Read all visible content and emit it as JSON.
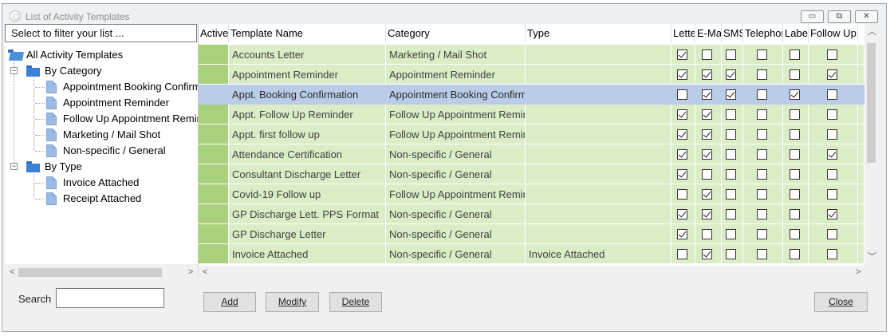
{
  "window": {
    "title": "List of Activity Templates",
    "controls": [
      "▭",
      "⧉",
      "✕"
    ]
  },
  "filter": {
    "placeholder": "Select to filter your list ..."
  },
  "tree": {
    "root": "All Activity Templates",
    "by_category": {
      "label": "By Category",
      "items": [
        "Appointment Booking Confirmation",
        "Appointment Reminder",
        "Follow Up Appointment Reminder",
        "Marketing / Mail Shot",
        "Non-specific / General"
      ]
    },
    "by_type": {
      "label": "By Type",
      "items": [
        "Invoice Attached",
        "Receipt Attached"
      ]
    }
  },
  "grid": {
    "columns": [
      "Active",
      "Template Name",
      "Category",
      "Type",
      "Letter",
      "E-Mail",
      "SMS",
      "Telephone",
      "Label",
      "Follow Up"
    ],
    "rows": [
      {
        "name": "Accounts Letter",
        "category": "Marketing / Mail Shot",
        "type": "",
        "checks": [
          true,
          false,
          false,
          false,
          false,
          false
        ]
      },
      {
        "name": "Appointment Reminder",
        "category": "Appointment Reminder",
        "type": "",
        "checks": [
          true,
          true,
          true,
          false,
          false,
          true
        ]
      },
      {
        "name": "Appt. Booking Confirmation",
        "category": "Appointment Booking Confirmation",
        "type": "",
        "checks": [
          false,
          true,
          true,
          false,
          true,
          false
        ],
        "selected": true
      },
      {
        "name": "Appt. Follow Up Reminder",
        "category": "Follow Up Appointment Reminder",
        "type": "",
        "checks": [
          true,
          true,
          false,
          false,
          false,
          false
        ]
      },
      {
        "name": "Appt. first follow up",
        "category": "Follow Up Appointment Reminder",
        "type": "",
        "checks": [
          true,
          true,
          false,
          false,
          false,
          false
        ]
      },
      {
        "name": "Attendance Certification",
        "category": "Non-specific / General",
        "type": "",
        "checks": [
          true,
          true,
          false,
          false,
          false,
          true
        ]
      },
      {
        "name": "Consultant Discharge Letter",
        "category": "Non-specific / General",
        "type": "",
        "checks": [
          true,
          false,
          false,
          false,
          false,
          false
        ]
      },
      {
        "name": "Covid-19 Follow up",
        "category": "Follow Up Appointment Reminder",
        "type": "",
        "checks": [
          false,
          true,
          false,
          false,
          false,
          false
        ]
      },
      {
        "name": "GP Discharge Lett. PPS Format",
        "category": "Non-specific / General",
        "type": "",
        "checks": [
          true,
          true,
          false,
          false,
          false,
          true
        ]
      },
      {
        "name": "GP Discharge Letter",
        "category": "Non-specific / General",
        "type": "",
        "checks": [
          true,
          false,
          false,
          false,
          false,
          false
        ]
      },
      {
        "name": "Invoice Attached",
        "category": "Non-specific / General",
        "type": "Invoice Attached",
        "checks": [
          false,
          true,
          false,
          false,
          false,
          false
        ]
      }
    ]
  },
  "search": {
    "label": "Search",
    "value": ""
  },
  "buttons": {
    "add": "Add",
    "modify": "Modify",
    "delete": "Delete",
    "close": "Close"
  },
  "colors": {
    "row_bg": "#dbedc7",
    "active_col": "#a9d07a",
    "selected_bg": "#b9cde9"
  }
}
